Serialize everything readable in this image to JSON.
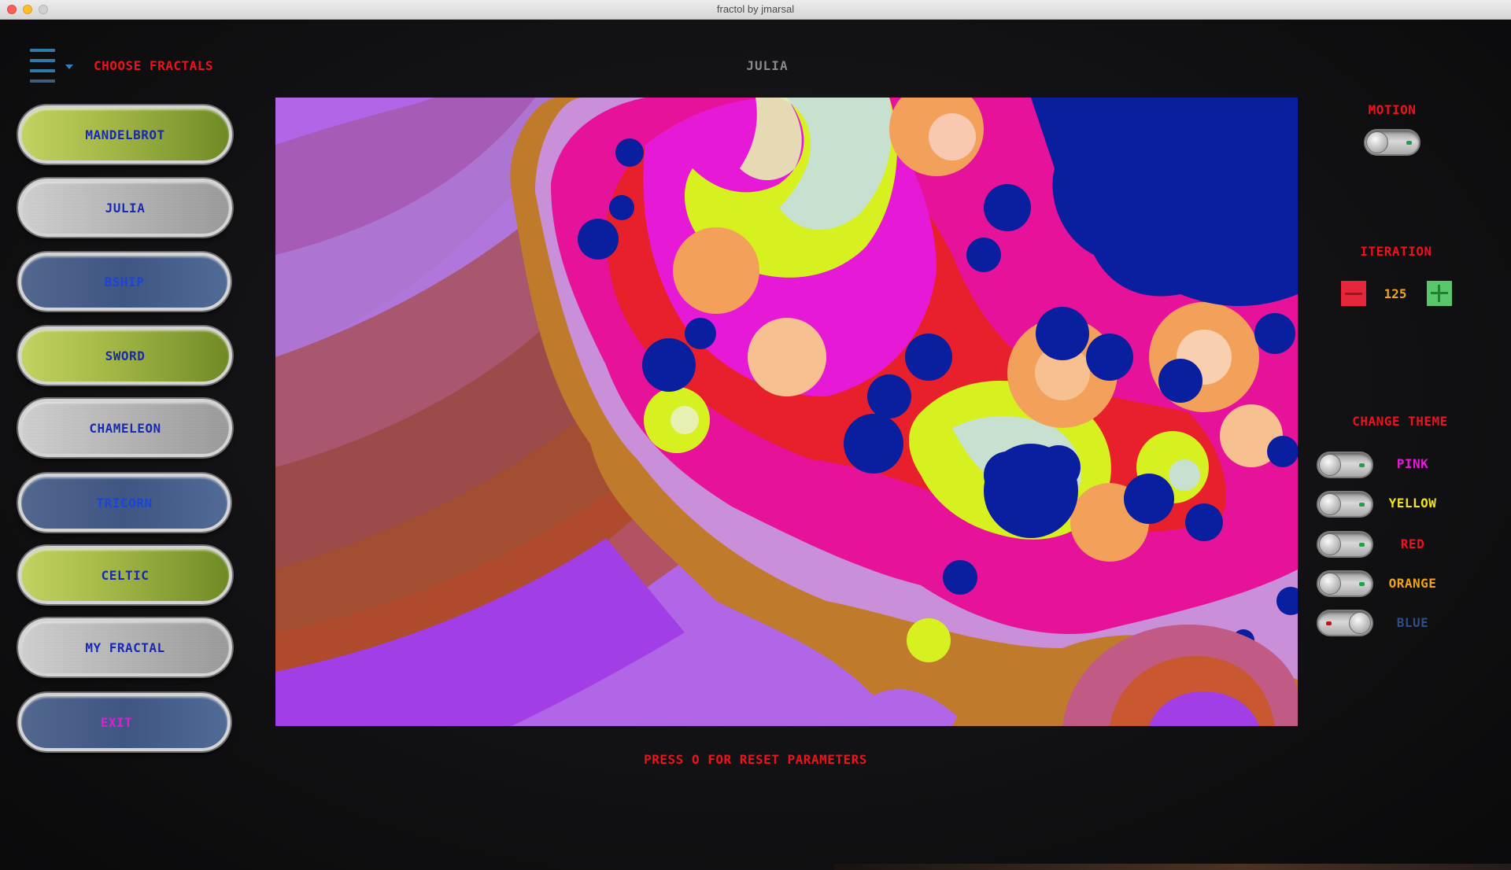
{
  "window": {
    "title": "fractol by jmarsal"
  },
  "header": {
    "menu_icon": "hamburger-menu-icon",
    "choose_label": "CHOOSE FRACTALS",
    "current_fractal": "JULIA"
  },
  "fractal_buttons": [
    {
      "label": "MANDELBROT",
      "style": "green"
    },
    {
      "label": "JULIA",
      "style": "silver"
    },
    {
      "label": "BSHIP",
      "style": "blue"
    },
    {
      "label": "SWORD",
      "style": "green"
    },
    {
      "label": "CHAMELEON",
      "style": "silver"
    },
    {
      "label": "TRICORN",
      "style": "blue"
    },
    {
      "label": "CELTIC",
      "style": "green"
    },
    {
      "label": "MY FRACTAL",
      "style": "silver"
    },
    {
      "label": "EXIT",
      "style": "blue"
    }
  ],
  "reset_hint": "PRESS O FOR RESET PARAMETERS",
  "right_panel": {
    "motion": {
      "label": "MOTION",
      "enabled": false
    },
    "iteration": {
      "label": "ITERATION",
      "value": "125",
      "minus_icon": "minus-icon",
      "plus_icon": "plus-icon"
    },
    "theme": {
      "label": "CHANGE THEME",
      "options": [
        {
          "label": "PINK",
          "color": "#e61ad6",
          "active": false
        },
        {
          "label": "YELLOW",
          "color": "#f2e318",
          "active": false
        },
        {
          "label": "RED",
          "color": "#e8141e",
          "active": false
        },
        {
          "label": "ORANGE",
          "color": "#f0a417",
          "active": false
        },
        {
          "label": "BLUE",
          "color": "#2e4f86",
          "active": true
        }
      ]
    }
  },
  "colors": {
    "accent_red": "#e8141e",
    "button_text_blue": "#1a2ab0",
    "fractal_set": "#0a1ea0",
    "fractal_magenta": "#e6139a",
    "fractal_yellow": "#d6f020",
    "fractal_purple": "#b066e6"
  }
}
